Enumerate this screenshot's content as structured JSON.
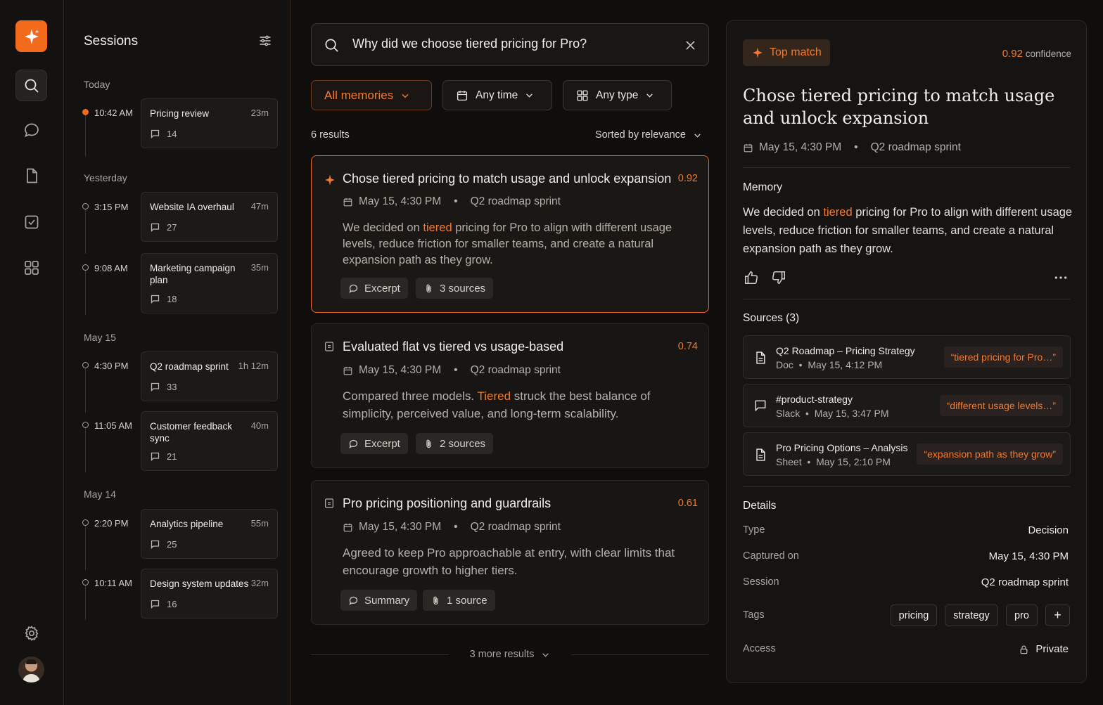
{
  "rail": {
    "icons": [
      "sparkle-icon",
      "search-icon",
      "chat-icon",
      "document-icon",
      "checkbox-icon",
      "grid-icon",
      "gear-icon",
      "avatar"
    ]
  },
  "sessions": {
    "title": "Sessions",
    "groups": [
      {
        "label": "Today",
        "items": [
          {
            "time": "10:42 AM",
            "title": "Pricing review",
            "duration": "23m",
            "count": "14",
            "live": true
          }
        ]
      },
      {
        "label": "Yesterday",
        "items": [
          {
            "time": "3:15 PM",
            "title": "Website IA overhaul",
            "duration": "47m",
            "count": "27"
          },
          {
            "time": "9:08 AM",
            "title": "Marketing campaign plan",
            "duration": "35m",
            "count": "18"
          }
        ]
      },
      {
        "label": "May 15",
        "items": [
          {
            "time": "4:30 PM",
            "title": "Q2 roadmap sprint",
            "duration": "1h 12m",
            "count": "33"
          },
          {
            "time": "11:05 AM",
            "title": "Customer feedback sync",
            "duration": "40m",
            "count": "21"
          }
        ]
      },
      {
        "label": "May 14",
        "items": [
          {
            "time": "2:20 PM",
            "title": "Analytics pipeline",
            "duration": "55m",
            "count": "25"
          },
          {
            "time": "10:11 AM",
            "title": "Design system updates",
            "duration": "32m",
            "count": "16"
          }
        ]
      }
    ]
  },
  "search": {
    "value": "Why did we choose tiered pricing for Pro?",
    "filters": {
      "memories": "All memories",
      "time": "Any time",
      "type": "Any type"
    },
    "results_count": "6 results",
    "sort": "Sorted by relevance",
    "more": "3 more results"
  },
  "results": [
    {
      "title": "Chose tiered pricing to match usage and unlock expansion",
      "score": "0.92",
      "date": "May 15, 4:30 PM",
      "session": "Q2 roadmap sprint",
      "body_pre": "We decided on ",
      "body_hl": "tiered",
      "body_post": " pricing for Pro to align with different usage levels, reduce friction for smaller teams, and create a natural expansion path as they grow.",
      "kind": "Excerpt",
      "sources": "3 sources"
    },
    {
      "title": "Evaluated flat vs tiered vs usage-based",
      "score": "0.74",
      "date": "May 15, 4:30 PM",
      "session": "Q2 roadmap sprint",
      "body_pre": "Compared three models. ",
      "body_hl": "Tiered",
      "body_post": " struck the best balance of simplicity, perceived value, and long-term scalability.",
      "kind": "Excerpt",
      "sources": "2 sources"
    },
    {
      "title": "Pro pricing positioning and guardrails",
      "score": "0.61",
      "date": "May 15, 4:30 PM",
      "session": "Q2 roadmap sprint",
      "body_pre": "Agreed to keep Pro approachable at entry, with clear limits that encourage growth to higher tiers.",
      "body_hl": "",
      "body_post": "",
      "kind": "Summary",
      "sources": "1 source"
    }
  ],
  "detail": {
    "badge": "Top match",
    "confidence_value": "0.92",
    "confidence_label": "confidence",
    "title": "Chose tiered pricing to match usage and unlock expansion",
    "date": "May 15, 4:30 PM",
    "session": "Q2 roadmap sprint",
    "memory_label": "Memory",
    "body_pre": "We decided on ",
    "body_hl": "tiered",
    "body_post": " pricing for Pro to align with different usage levels, reduce friction for smaller teams, and create a natural expansion path as they grow.",
    "sources_label": "Sources (3)",
    "sources": [
      {
        "icon": "document-icon",
        "title": "Q2 Roadmap – Pricing Strategy",
        "kind": "Doc",
        "time": "May 15, 4:12 PM",
        "quote": "“tiered pricing for Pro…”"
      },
      {
        "icon": "chat-icon",
        "title": "#product-strategy",
        "kind": "Slack",
        "time": "May 15, 3:47 PM",
        "quote": "“different usage levels…”"
      },
      {
        "icon": "document-icon",
        "title": "Pro Pricing Options – Analysis",
        "kind": "Sheet",
        "time": "May 15, 2:10 PM",
        "quote": "“expansion path as they grow”"
      }
    ],
    "details_label": "Details",
    "rows": {
      "type_k": "Type",
      "type_v": "Decision",
      "captured_k": "Captured on",
      "captured_v": "May 15, 4:30 PM",
      "session_k": "Session",
      "session_v": "Q2 roadmap sprint",
      "tags_k": "Tags",
      "access_k": "Access",
      "access_v": "Private"
    },
    "tags": [
      "pricing",
      "strategy",
      "pro",
      "+"
    ]
  },
  "colors": {
    "accent": "#f26a1b",
    "background": "#0f0e0d",
    "panel": "#151413"
  }
}
